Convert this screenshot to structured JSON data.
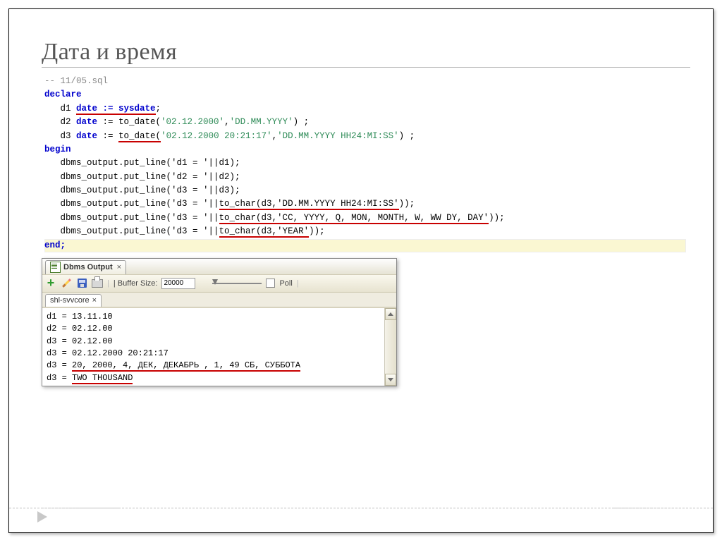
{
  "title": "Дата и время",
  "code": {
    "comment": "-- 11/05.sql",
    "declare": "declare",
    "d1_pre": "   d1 ",
    "d1_u": "date := sysdate",
    "d1_post": ";",
    "d2_pre": "   d2 ",
    "d2_kw": "date",
    "d2_mid": " := to_date(",
    "d2_s1": "'02.12.2000'",
    "d2_c": ",",
    "d2_s2": "'DD.MM.YYYY'",
    "d2_end": ") ;",
    "d3_pre": "   d3 ",
    "d3_kw": "date",
    "d3_mid": " := ",
    "d3_u": "to_date(",
    "d3_s1": "'02.12.2000 20:21:17'",
    "d3_c": ",",
    "d3_s2": "'DD.MM.YYYY HH24:MI:SS'",
    "d3_end": ") ;",
    "begin": "begin",
    "l1": "   dbms_output.put_line('d1 = '||d1);",
    "l2": "   dbms_output.put_line('d2 = '||d2);",
    "l3": "   dbms_output.put_line('d3 = '||d3);",
    "l4_pre": "   dbms_output.put_line('d3 = '||",
    "l4_u": "to_char(d3,'DD.MM.YYYY HH24:MI:SS'",
    "l4_post": "));",
    "l5_pre": "   dbms_output.put_line('d3 = '||",
    "l5_u": "to_char(d3,'CC, YYYY, Q, MON, MONTH, W, WW DY, DAY'",
    "l5_post": "));",
    "l6_pre": "   dbms_output.put_line('d3 = '||",
    "l6_u": "to_char(d3,'YEAR'",
    "l6_post": "));",
    "end": "end;"
  },
  "panel": {
    "title": "Dbms Output",
    "buffer_label": "| Buffer Size:",
    "buffer_value": "20000",
    "poll_label": "Poll",
    "conn_tab": "shl-svvcore"
  },
  "output": {
    "o1": "d1 = 13.11.10",
    "o2": "d2 = 02.12.00",
    "o3": "d3 = 02.12.00",
    "o4": "d3 = 02.12.2000 20:21:17",
    "o5_pre": "d3 = ",
    "o5_u": "20, 2000, 4, ДЕК, ДЕКАБРЬ , 1, 49 СБ, СУББОТА",
    "o6_pre": "d3 = ",
    "o6_u": "TWO THOUSAND"
  }
}
